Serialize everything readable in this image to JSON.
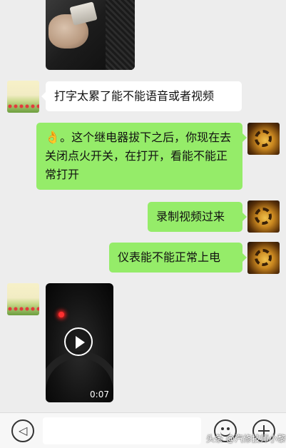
{
  "messages": [
    {
      "type": "image",
      "side": "left",
      "caption_icon": "photo-relay-in-hand"
    },
    {
      "type": "text",
      "side": "left",
      "text": "打字太累了能不能语音或者视频"
    },
    {
      "type": "text",
      "side": "right",
      "emoji": "👌",
      "text": "。这个继电器拔下之后，你现在去关闭点火开关，在打开，看能不能正常打开"
    },
    {
      "type": "text",
      "side": "right",
      "text": "录制视频过来"
    },
    {
      "type": "text",
      "side": "right",
      "text": "仪表能不能正常上电"
    },
    {
      "type": "video",
      "side": "left",
      "duration": "0:07"
    }
  ],
  "input_bar": {
    "voice_icon": "voice-icon",
    "voice_glyph": "◁))",
    "emoji_icon": "emoji-icon",
    "plus_icon": "plus-icon"
  },
  "watermark": "头条 @汽修技师小黎",
  "colors": {
    "background": "#ededed",
    "bubble_sent": "#95ec69",
    "bubble_received": "#ffffff"
  }
}
